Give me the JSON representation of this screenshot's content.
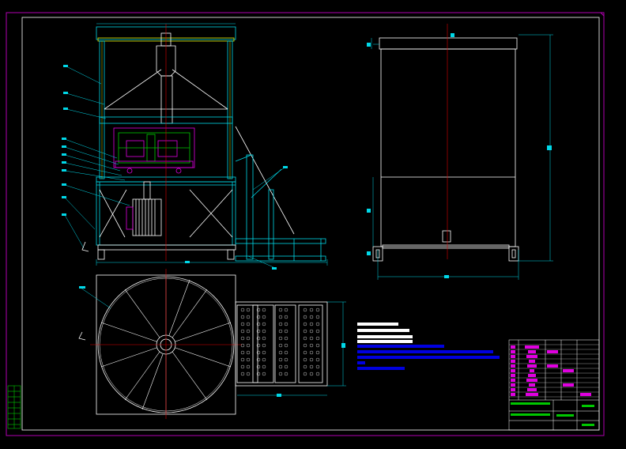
{
  "drawing": {
    "type": "cad-engineering-drawing",
    "background": "#000000",
    "colors": {
      "frame": "#b000b0",
      "geometry": "#ffffff",
      "dimension": "#00d8e8",
      "centerline": "#e00000",
      "highlight": "#e000e0",
      "subassembly": "#00c800",
      "yellow": "#e8e800",
      "notes_white": "#ffffff",
      "notes_blue": "#0000e0"
    },
    "views": [
      "front-elevation",
      "side-elevation",
      "plan-view"
    ],
    "text": []
  }
}
